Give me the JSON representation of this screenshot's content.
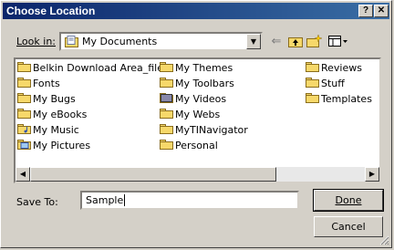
{
  "dialog": {
    "title": "Choose Location",
    "look_in_label": "Look in:",
    "look_in_value": "My Documents",
    "save_to_label": "Save To:",
    "save_to_value": "Sample",
    "done_label": "Done",
    "cancel_label": "Cancel",
    "help_label": "?",
    "close_label": "✕"
  },
  "files": {
    "col1": [
      {
        "name": "Belkin Download Area_files",
        "icon": "folder-icon"
      },
      {
        "name": "Fonts",
        "icon": "folder-icon"
      },
      {
        "name": "My Bugs",
        "icon": "folder-icon"
      },
      {
        "name": "My eBooks",
        "icon": "folder-icon"
      },
      {
        "name": "My Music",
        "icon": "music-folder-icon"
      },
      {
        "name": "My Pictures",
        "icon": "pictures-folder-icon"
      }
    ],
    "col2": [
      {
        "name": "My Themes",
        "icon": "folder-icon"
      },
      {
        "name": "My Toolbars",
        "icon": "folder-icon"
      },
      {
        "name": "My Videos",
        "icon": "video-folder-icon"
      },
      {
        "name": "My Webs",
        "icon": "folder-icon"
      },
      {
        "name": "MyTINavigator",
        "icon": "folder-icon"
      },
      {
        "name": "Personal",
        "icon": "folder-icon"
      }
    ],
    "col3": [
      {
        "name": "Reviews",
        "icon": "folder-icon"
      },
      {
        "name": "Stuff",
        "icon": "folder-icon"
      },
      {
        "name": "Templates",
        "icon": "folder-icon"
      }
    ]
  },
  "colors": {
    "title_start": "#0a246a",
    "title_end": "#3a6ea5",
    "folder": "#f6d86a",
    "face": "#d4d0c8"
  }
}
